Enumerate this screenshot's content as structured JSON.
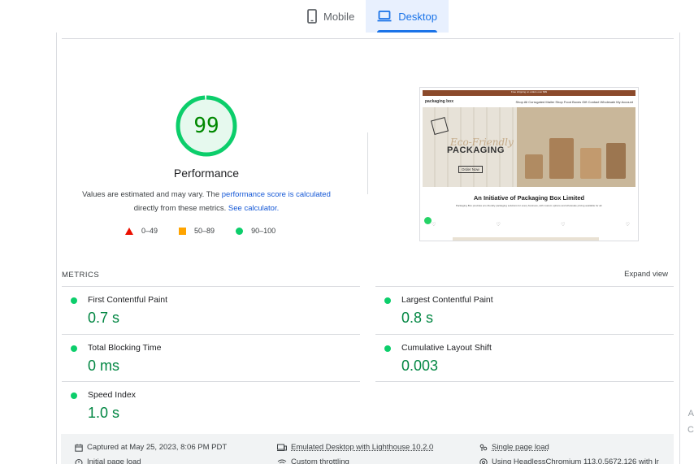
{
  "tabs": [
    {
      "label": "Mobile",
      "icon": "smartphone-icon",
      "active": false
    },
    {
      "label": "Desktop",
      "icon": "laptop-icon",
      "active": true
    }
  ],
  "performance": {
    "score": "99",
    "title": "Performance",
    "note_prefix": "Values are estimated and may vary. The ",
    "note_link1": "performance score is calculated",
    "note_mid": " directly from these metrics. ",
    "note_link2": "See calculator.",
    "legend": [
      {
        "range": "0–49",
        "shape": "triangle",
        "color": "#eb0f00"
      },
      {
        "range": "50–89",
        "shape": "square",
        "color": "#ffa400"
      },
      {
        "range": "90–100",
        "shape": "circle",
        "color": "#0cce6b"
      }
    ]
  },
  "screenshot": {
    "topbar": "Free shipping on orders over $99",
    "logo": "packaging box",
    "nav": "Shop All   Corrugated   Mailer   Shop   Food Boxes   Gift   Contact   Wholesale   My Account",
    "hero_script": "Eco-Friendly",
    "hero_title": "PACKAGING",
    "hero_button": "Order Now",
    "heading": "An Initiative of Packaging Box Limited",
    "paragraph": "Packaging Box provides eco-friendly packaging solutions for every business, with custom options and wholesale pricing available for all."
  },
  "metrics": {
    "label": "METRICS",
    "expand": "Expand view",
    "items": [
      {
        "name": "First Contentful Paint",
        "value": "0.7 s"
      },
      {
        "name": "Largest Contentful Paint",
        "value": "0.8 s"
      },
      {
        "name": "Total Blocking Time",
        "value": "0 ms"
      },
      {
        "name": "Cumulative Layout Shift",
        "value": "0.003"
      },
      {
        "name": "Speed Index",
        "value": "1.0 s"
      }
    ]
  },
  "info": {
    "captured": "Captured at May 25, 2023, 8:06 PM PDT",
    "emulated": "Emulated Desktop with Lighthouse 10.2.0",
    "single_page": "Single page load",
    "initial_load": "Initial page load",
    "throttling": "Custom throttling",
    "browser": "Using HeadlessChromium 113.0.5672.126 with lr"
  },
  "side": {
    "a": "A",
    "c": "C"
  },
  "colors": {
    "good": "#0cce6b",
    "good_text": "#018642",
    "accent": "#1a73e8"
  }
}
